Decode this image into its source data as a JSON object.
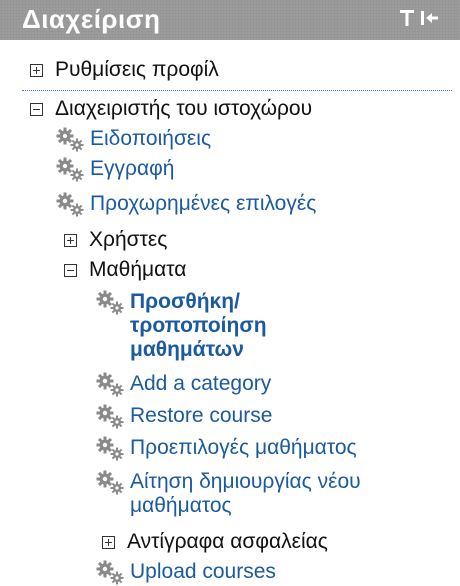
{
  "header": {
    "title": "Διαχείριση"
  },
  "items": {
    "profile_settings": "Ρυθμίσεις προφίλ",
    "site_admin": "Διαχειριστής του ιστοχώρου",
    "notifications": "Ειδοποιήσεις",
    "registration": "Εγγραφή",
    "advanced_features": "Προχωρημένες επιλογές",
    "users": "Χρήστες",
    "courses": "Μαθήματα",
    "add_edit_courses": "Προσθήκη/ τροποποίηση μαθημάτων",
    "add_category": "Add a category",
    "restore_course": "Restore course",
    "course_defaults": "Προεπιλογές μαθήματος",
    "course_request": "Αίτηση δημιουργίας νέου μαθήματος",
    "backups": "Αντίγραφα ασφαλείας",
    "upload_courses": "Upload courses"
  },
  "icons": {
    "expand": "plus-box-icon",
    "collapse": "minus-box-icon",
    "setting": "gear-icon",
    "dock": "dock-icon",
    "collapse_block": "collapse-block-icon"
  },
  "colors": {
    "link": "#1b5a9e",
    "header_bg": "#9c9c9c",
    "text": "#111111"
  }
}
